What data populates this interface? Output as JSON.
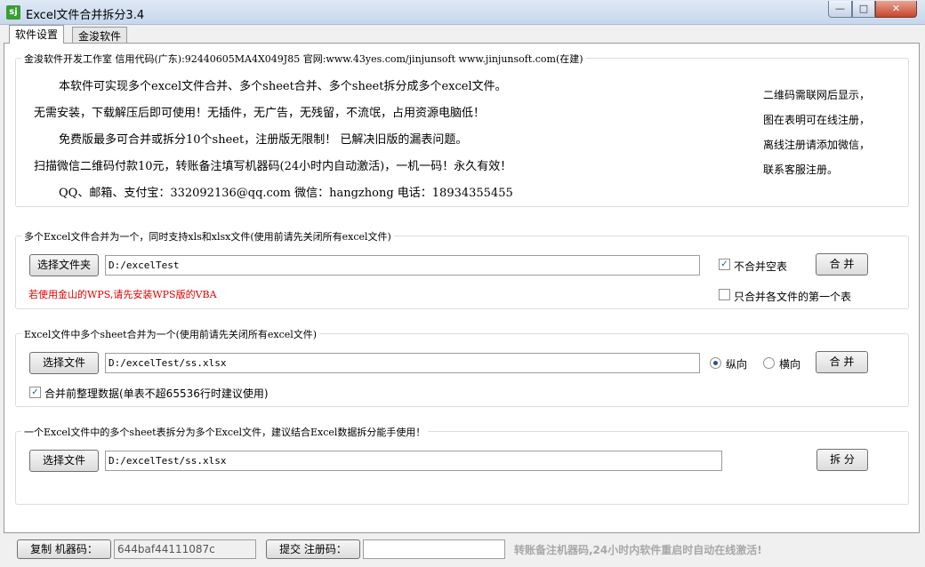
{
  "window": {
    "title": "Excel文件合并拆分3.4",
    "app_icon": "sj",
    "minimize": "—",
    "maximize": "□",
    "close": "✕"
  },
  "tabs": [
    {
      "label": "软件设置",
      "active": true
    },
    {
      "label": "金浚软件",
      "active": false
    }
  ],
  "info": {
    "header": "金浚软件开发工作室 信用代码(广东):92440605MA4X049J85 官网:www.43yes.com/jinjunsoft  www.jinjunsoft.com(在建)",
    "lines": [
      "本软件可实现多个excel文件合并、多个sheet合并、多个sheet拆分成多个excel文件。",
      "无需安装，下载解压后即可使用！无插件，无广告，无残留，不流氓，占用资源电脑低！",
      "免费版最多可合并或拆分10个sheet，注册版无限制！ 已解决旧版的漏表问题。",
      "扫描微信二维码付款10元，转账备注填写机器码(24小时内自动激活)，一机一码！永久有效！",
      "QQ、邮箱、支付宝：332092136@qq.com    微信：hangzhong    电话：18934355455"
    ],
    "side_notes": [
      "二维码需联网后显示，",
      "图在表明可在线注册，",
      "离线注册请添加微信，",
      "联系客服注册。"
    ]
  },
  "merge_files": {
    "legend": "多个Excel文件合并为一个，同时支持xls和xlsx文件(使用前请先关闭所有excel文件)",
    "browse_label": "选择文件夹",
    "path": "D:/excelTest",
    "skip_empty_label": "不合并空表",
    "skip_empty_checked": true,
    "first_sheet_only_label": "只合并各文件的第一个表",
    "first_sheet_only_checked": false,
    "merge_label": "合 并",
    "wps_warning": "若使用金山的WPS,请先安装WPS版的VBA"
  },
  "merge_sheets": {
    "legend": "Excel文件中多个sheet合并为一个(使用前请先关闭所有excel文件)",
    "browse_label": "选择文件",
    "path": "D:/excelTest/ss.xlsx",
    "vertical_label": "纵向",
    "horizontal_label": "横向",
    "selected_direction": "纵向",
    "merge_label": "合 并",
    "tidy_label": "合并前整理数据(单表不超65536行时建议使用)",
    "tidy_checked": true
  },
  "split_sheets": {
    "legend": "一个Excel文件中的多个sheet表拆分为多个Excel文件，建议结合Excel数据拆分能手使用！",
    "browse_label": "选择文件",
    "path": "D:/excelTest/ss.xlsx",
    "split_label": "拆 分"
  },
  "status": {
    "copy_machine_label": "复制 机器码：",
    "machine_code": "644baf44111087c",
    "submit_reg_label": "提交 注册码：",
    "reg_code": "",
    "note": "转账备注机器码,24小时内软件重启时自动在线激活!"
  },
  "colors": {
    "warning": "#e00000",
    "title_bar": "#c6d7ec",
    "close_button": "#c7452a"
  }
}
